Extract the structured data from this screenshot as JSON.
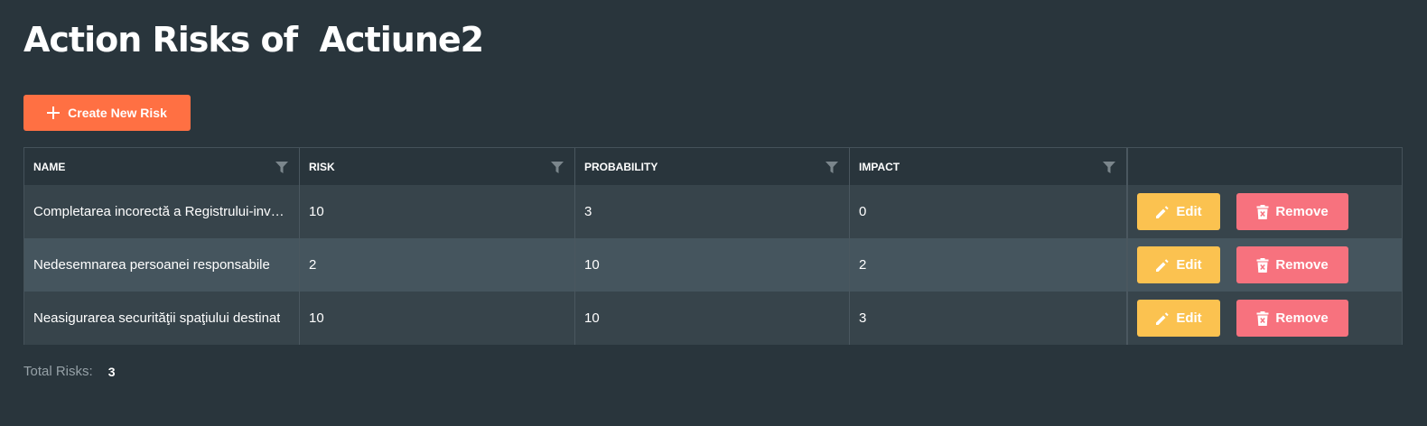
{
  "page": {
    "title": "Action Risks of  Actiune2"
  },
  "toolbar": {
    "create_label": "Create New Risk",
    "create_icon": "plus-icon"
  },
  "table": {
    "columns": [
      "NAME",
      "RISK",
      "PROBABILITY",
      "IMPACT"
    ],
    "filter_icon": "filter-icon",
    "rows": [
      {
        "name": "Completarea incorectă a Registrului-inventar",
        "risk": "10",
        "probability": "3",
        "impact": "0"
      },
      {
        "name": "Nedesemnarea persoanei responsabile",
        "risk": "2",
        "probability": "10",
        "impact": "2"
      },
      {
        "name": "Neasigurarea securităţii spaţiului destinat",
        "risk": "10",
        "probability": "10",
        "impact": "3"
      }
    ],
    "actions": {
      "edit_label": "Edit",
      "remove_label": "Remove",
      "edit_icon": "pencil-icon",
      "remove_icon": "trash-icon"
    }
  },
  "footer": {
    "total_label": "Total Risks:",
    "total_count": "3"
  },
  "colors": {
    "background": "#29353c",
    "accent_create": "#ff7043",
    "edit": "#fbc250",
    "remove": "#f7727e",
    "row_odd": "#37444b",
    "row_even": "#45555e"
  }
}
